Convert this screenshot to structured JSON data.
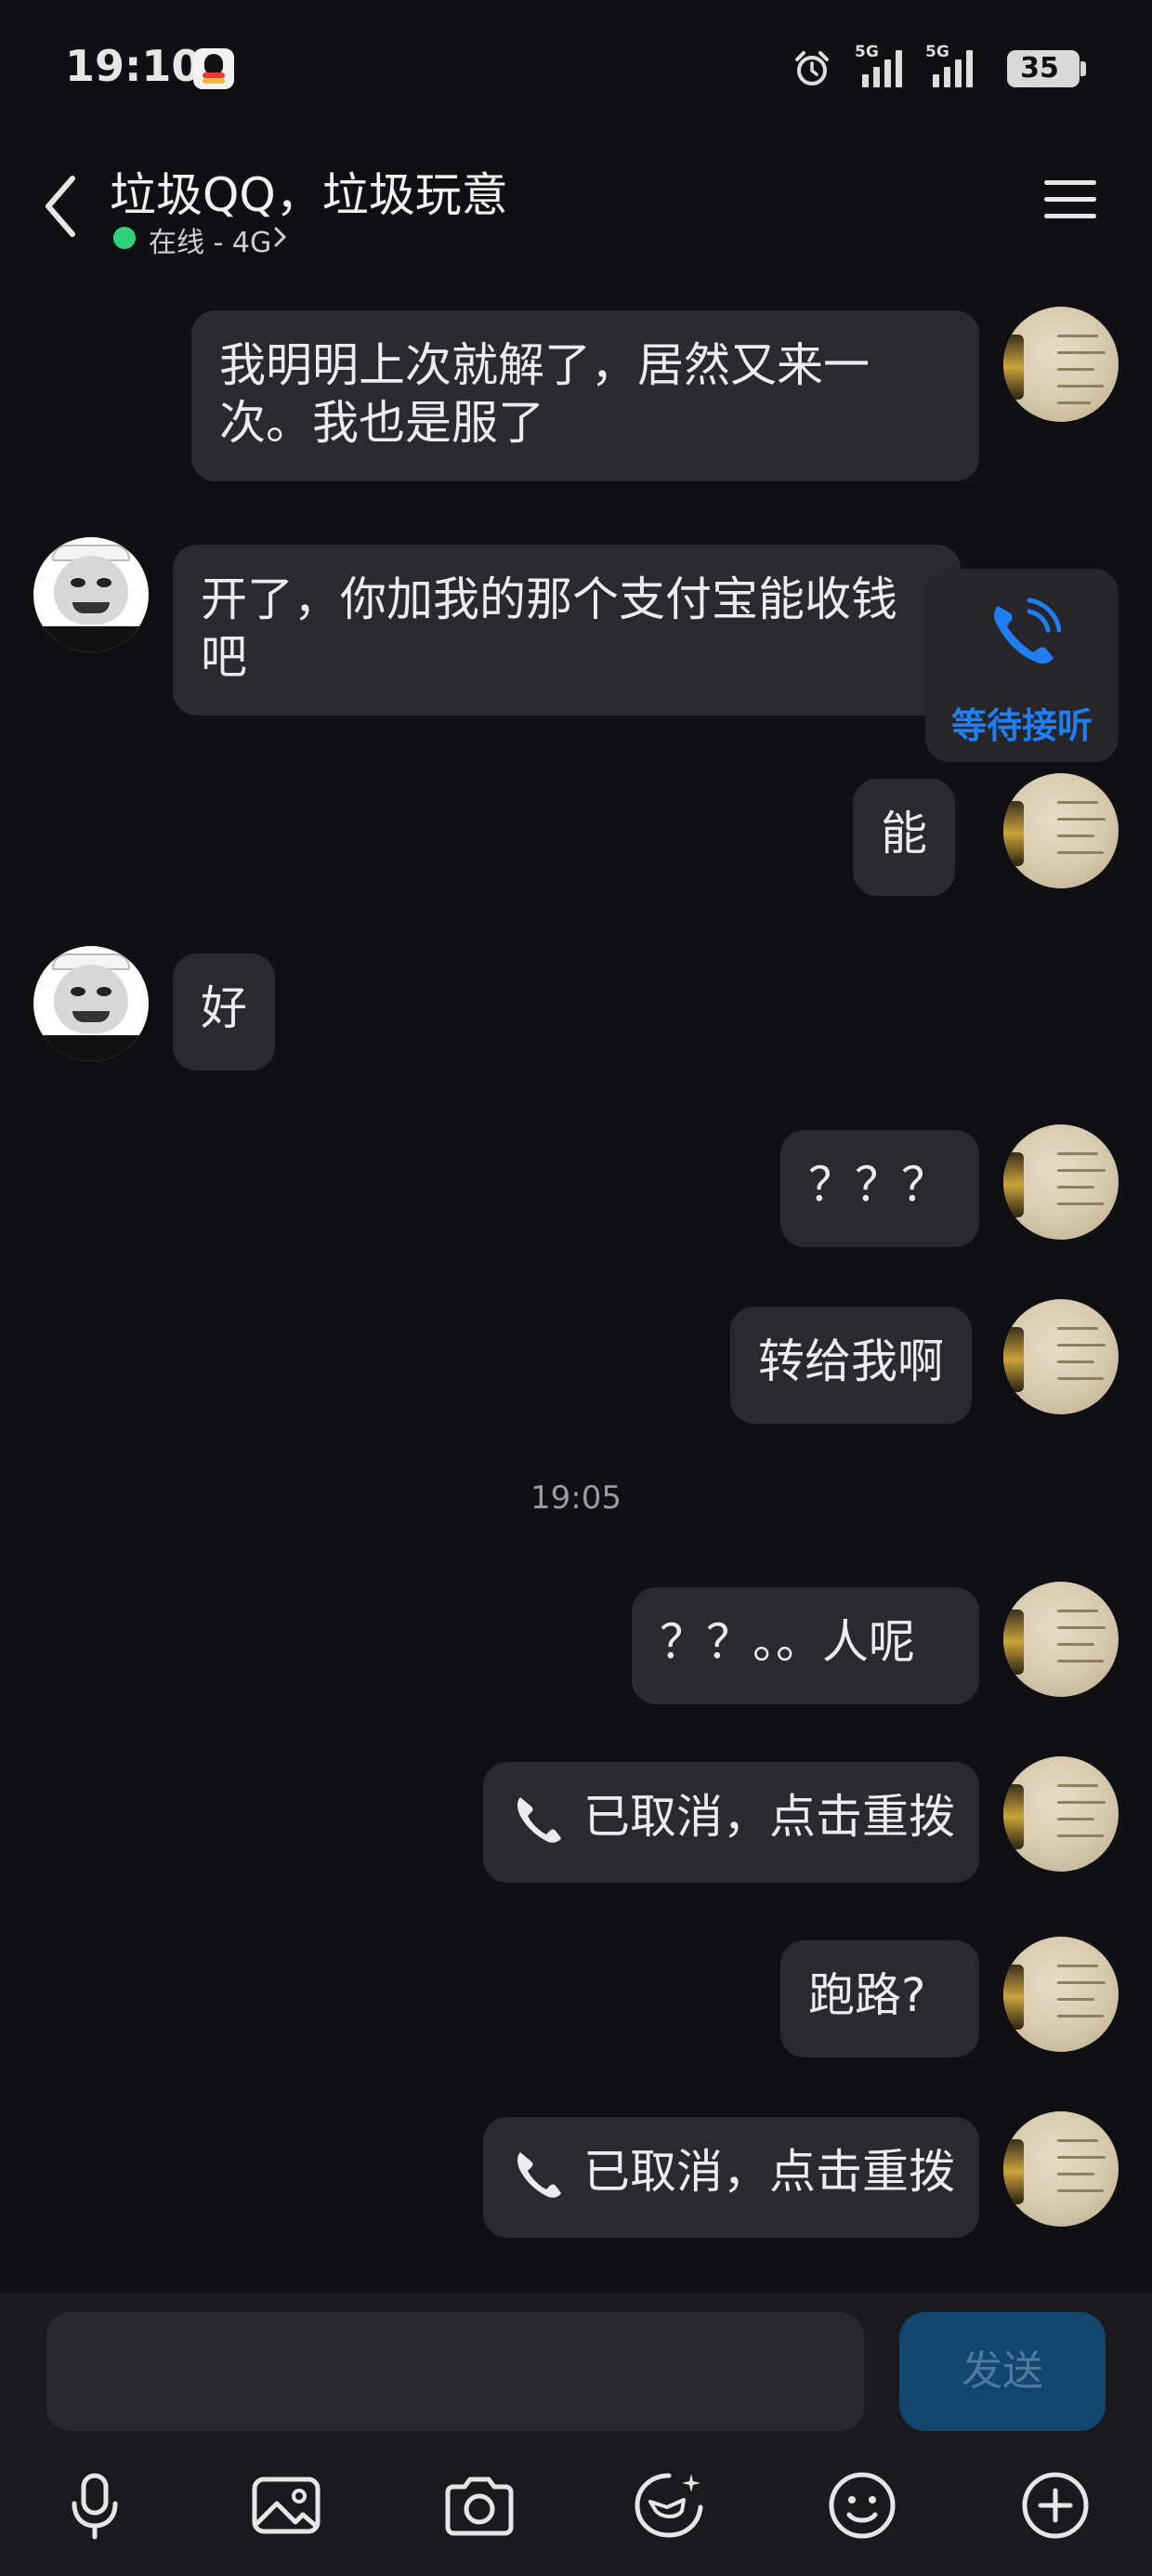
{
  "status_bar": {
    "time": "19:10",
    "signal_1_label": "5G",
    "signal_2_label": "5G",
    "battery": "35"
  },
  "header": {
    "contact_name": "垃圾QQ，垃圾玩意",
    "online_status": "在线 - 4G"
  },
  "messages": [
    {
      "from": "self",
      "text": "我明明上次就解了，居然又来一次。我也是服了"
    },
    {
      "from": "peer",
      "text": "开了，你加我的那个支付宝能收钱吧"
    },
    {
      "from": "self",
      "text": "能"
    },
    {
      "from": "peer",
      "text": "好"
    },
    {
      "from": "self",
      "text": "？？？"
    },
    {
      "from": "self",
      "text": "转给我啊"
    },
    {
      "from": "self",
      "text": "？？。。人呢"
    },
    {
      "from": "self",
      "text": "已取消，点击重拨",
      "type": "call"
    },
    {
      "from": "self",
      "text": "跑路?"
    },
    {
      "from": "self",
      "text": "已取消，点击重拨",
      "type": "call"
    }
  ],
  "time_separator": "19:05",
  "waiting_call": {
    "label": "等待接听"
  },
  "composer": {
    "input_value": "",
    "send_label": "发送"
  },
  "toolbar": [
    "microphone-icon",
    "image-icon",
    "camera-icon",
    "sticker-icon",
    "emoji-icon",
    "plus-icon"
  ],
  "colors": {
    "background": "#101014",
    "bubble": "#2a2a2e",
    "accent_blue": "#1f7ef0",
    "online_green": "#2fd27a",
    "send_button": "#12466e"
  }
}
